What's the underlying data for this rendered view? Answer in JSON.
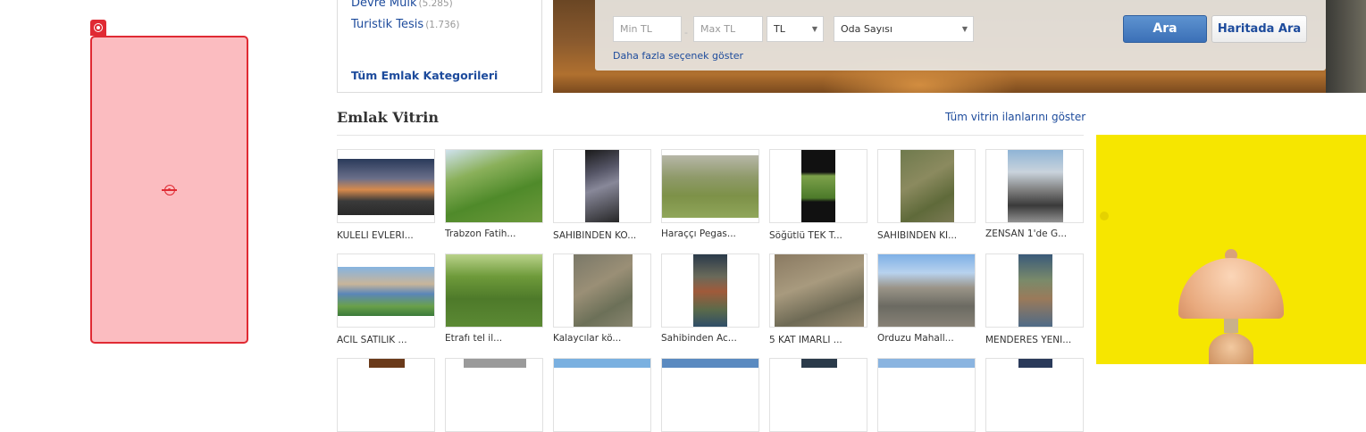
{
  "categories": {
    "items": [
      {
        "label": "Devre Mülk",
        "count": "(5.285)"
      },
      {
        "label": "Turistik Tesis",
        "count": "(1.736)"
      }
    ],
    "all_label": "Tüm Emlak Kategorileri"
  },
  "search": {
    "min_placeholder": "Min TL",
    "max_placeholder": "Max TL",
    "currency": "TL",
    "rooms": "Oda Sayısı",
    "more_options": "Daha fazla seçenek göster",
    "search_button": "Ara",
    "map_button": "Haritada Ara"
  },
  "vitrin": {
    "title": "Emlak Vitrin",
    "show_all": "Tüm vitrin ilanlarını göster",
    "rows": [
      [
        "KULELİ EVLERİ...",
        "Trabzon Fatih...",
        "SAHİBİNDEN KO...",
        "Haraççı Pegas...",
        "Söğütlü TEK T...",
        "SAHİBİNDEN Kİ...",
        "ZENSAN 1'de G..."
      ],
      [
        "ACİL SATILIK ...",
        "Etrafı tel il...",
        "Kalaycılar kö...",
        "Sahibinden Ac...",
        "5 KAT İMARLI ...",
        "Orduzu Mahall...",
        "MENDERES YENİ..."
      ]
    ]
  },
  "colors": {
    "link": "#1d4b9c",
    "primary_button": "#3b70b7",
    "ad_placeholder": "#fbbcc0",
    "ad_border": "#e02a33",
    "ad_right_bg": "#f6e600"
  },
  "icons": [
    "ad-badge-icon",
    "crosshair-icon",
    "dropdown-arrow-icon"
  ]
}
